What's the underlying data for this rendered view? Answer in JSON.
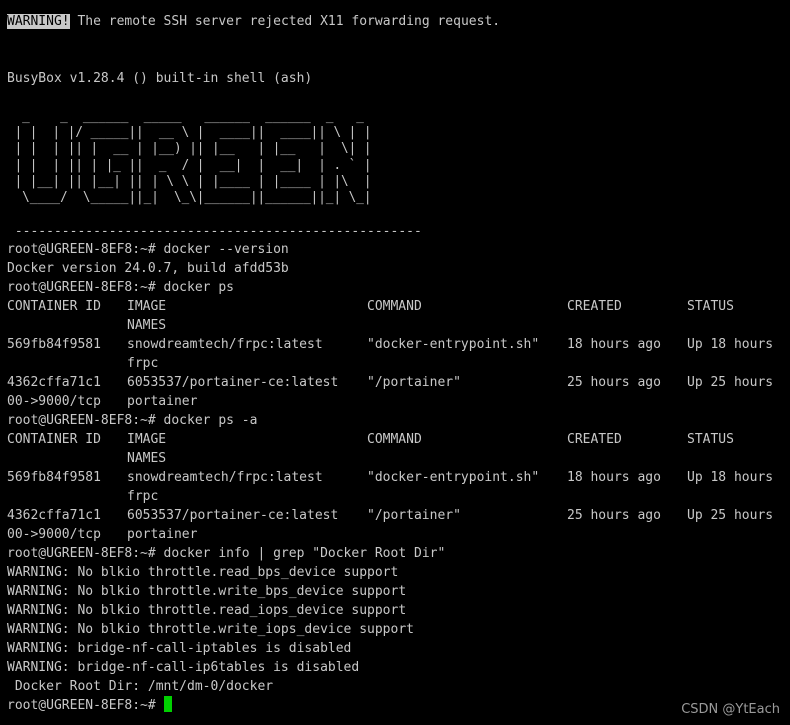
{
  "terminal": {
    "x11_warning_tag": "WARNING!",
    "x11_warning_text": " The remote SSH server rejected X11 forwarding request.",
    "busybox_banner": "BusyBox v1.28.4 () built-in shell (ash)",
    "logo_art": "  _    _  ______  _____   ______  ______  _   _\n | |  | |/ _____||  __ \\ |  ____||  ____|| \\ | |\n | |  | || |  __ | |__) || |__   | |__   |  \\| |\n | |  | || | |_ ||  _  / |  __|  |  __|  | . ` |\n | |__| || |__| || | \\ \\ | |____ | |____ | |\\  |\n  \\____/  \\_____||_|  \\_\\|______||______||_| \\_|",
    "separator": " ----------------------------------------------------",
    "lines": {
      "l1": "root@UGREEN-8EF8:~# docker --version",
      "l2": "Docker version 24.0.7, build afdd53b",
      "l3": "root@UGREEN-8EF8:~# docker ps",
      "l9": "root@UGREEN-8EF8:~# docker ps -a",
      "l15": "root@UGREEN-8EF8:~# docker info | grep \"Docker Root Dir\"",
      "w1": "WARNING: No blkio throttle.read_bps_device support",
      "w2": "WARNING: No blkio throttle.write_bps_device support",
      "w3": "WARNING: No blkio throttle.read_iops_device support",
      "w4": "WARNING: No blkio throttle.write_iops_device support",
      "w5": "WARNING: bridge-nf-call-iptables is disabled",
      "w6": "WARNING: bridge-nf-call-ip6tables is disabled",
      "root_dir": " Docker Root Dir: /mnt/dm-0/docker",
      "final_prompt": "root@UGREEN-8EF8:~# "
    },
    "table_headers": {
      "container_id": "CONTAINER ID",
      "image": "IMAGE",
      "command": "COMMAND",
      "created": "CREATED",
      "status": "STATUS",
      "names": "NAMES"
    },
    "containers": [
      {
        "id": "569fb84f9581",
        "image": "snowdreamtech/frpc:latest",
        "command": "\"docker-entrypoint.sh\"",
        "created": "18 hours ago",
        "status": "Up 18 hours",
        "wrap_prefix": "",
        "name": "frpc"
      },
      {
        "id": "4362cffa71c1",
        "image": "6053537/portainer-ce:latest",
        "command": "\"/portainer\"",
        "created": "25 hours ago",
        "status": "Up 25 hours",
        "wrap_prefix": "00->9000/tcp",
        "name": "portainer"
      }
    ]
  },
  "watermark": "CSDN @YtEach"
}
